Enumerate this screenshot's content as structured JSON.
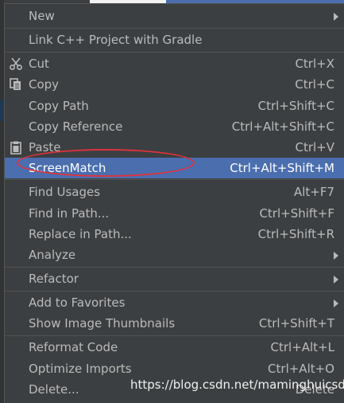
{
  "menu": {
    "items": [
      {
        "label": "New",
        "shortcut": "",
        "submenu": true
      },
      {
        "label": "Link C++ Project with Gradle",
        "shortcut": "",
        "submenu": false
      },
      {
        "label": "Cut",
        "shortcut": "Ctrl+X",
        "icon": "scissors-icon"
      },
      {
        "label": "Copy",
        "shortcut": "Ctrl+C",
        "icon": "copy-icon"
      },
      {
        "label": "Copy Path",
        "shortcut": "Ctrl+Shift+C"
      },
      {
        "label": "Copy Reference",
        "shortcut": "Ctrl+Alt+Shift+C"
      },
      {
        "label": "Paste",
        "shortcut": "Ctrl+V",
        "icon": "clipboard-icon"
      },
      {
        "label": "ScreenMatch",
        "shortcut": "Ctrl+Alt+Shift+M",
        "selected": true
      },
      {
        "label": "Find Usages",
        "shortcut": "Alt+F7"
      },
      {
        "label": "Find in Path...",
        "shortcut": "Ctrl+Shift+F"
      },
      {
        "label": "Replace in Path...",
        "shortcut": "Ctrl+Shift+R"
      },
      {
        "label": "Analyze",
        "shortcut": "",
        "submenu": true
      },
      {
        "label": "Refactor",
        "shortcut": "",
        "submenu": true
      },
      {
        "label": "Add to Favorites",
        "shortcut": "",
        "submenu": true
      },
      {
        "label": "Show Image Thumbnails",
        "shortcut": "Ctrl+Shift+T"
      },
      {
        "label": "Reformat Code",
        "shortcut": "Ctrl+Alt+L"
      },
      {
        "label": "Optimize Imports",
        "shortcut": "Ctrl+Alt+O"
      },
      {
        "label": "Delete...",
        "shortcut": "Delete"
      }
    ]
  },
  "watermark": "https://blog.csdn.net/maminghuicsdn",
  "colors": {
    "menu_bg": "#3c3f41",
    "selected_bg": "#4b6eaf",
    "text": "#bbbbbb",
    "annotation": "#e0323c"
  }
}
